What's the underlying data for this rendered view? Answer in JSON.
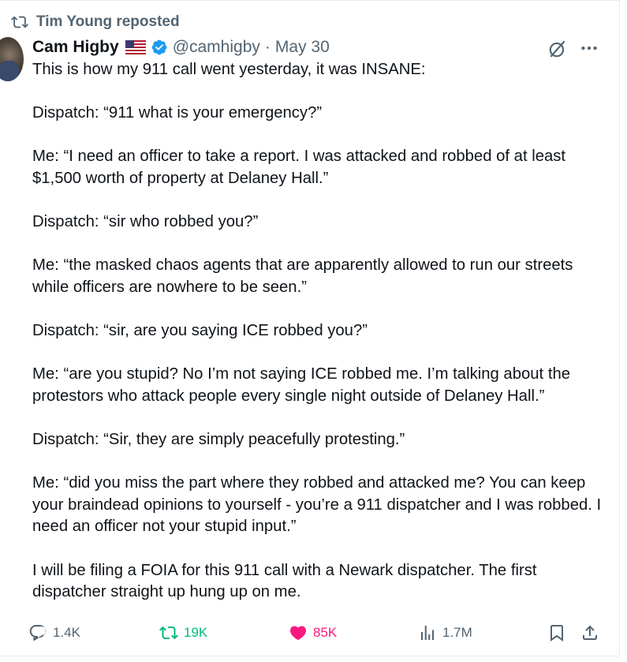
{
  "repost": {
    "text": "Tim Young reposted"
  },
  "author": {
    "name": "Cam Higby",
    "handle": "@camhigby",
    "separator": "·",
    "date": "May 30"
  },
  "icons": {
    "repost": "repost-icon",
    "flag": "us-flag-icon",
    "verified": "verified-badge-icon",
    "grok": "grok-icon",
    "more": "more-icon",
    "reply": "reply-icon",
    "like": "heart-icon",
    "views": "views-icon",
    "bookmark": "bookmark-icon",
    "share": "share-icon"
  },
  "colors": {
    "repost_active": "#00ba7c",
    "like_active": "#f91880",
    "verified": "#1d9bf0",
    "muted": "#536471"
  },
  "tweet": {
    "paragraphs": [
      "This is how my 911 call went yesterday, it was INSANE:",
      "Dispatch: “911 what is your emergency?”",
      "Me: “I need an officer to take a report. I was attacked and robbed of at least $1,500 worth of property at Delaney Hall.”",
      "Dispatch: “sir who robbed you?”",
      "Me: “the masked chaos agents that are apparently allowed to run our streets while officers are nowhere to be seen.”",
      "Dispatch: “sir, are you saying ICE robbed you?”",
      "Me: “are you stupid? No I’m not saying ICE robbed me. I’m talking about the protestors who attack people every single night outside of Delaney Hall.”",
      "Dispatch: “Sir, they are simply peacefully protesting.”",
      "Me: “did you miss the part where they robbed and attacked me? You can keep your braindead opinions to yourself - you’re a 911 dispatcher and I was robbed. I need an officer not your stupid input.”",
      "I will be filing a FOIA for this 911 call with a Newark dispatcher. The first dispatcher straight up hung up on me."
    ]
  },
  "actions": {
    "replies": "1.4K",
    "reposts": "19K",
    "likes": "85K",
    "views": "1.7M"
  }
}
